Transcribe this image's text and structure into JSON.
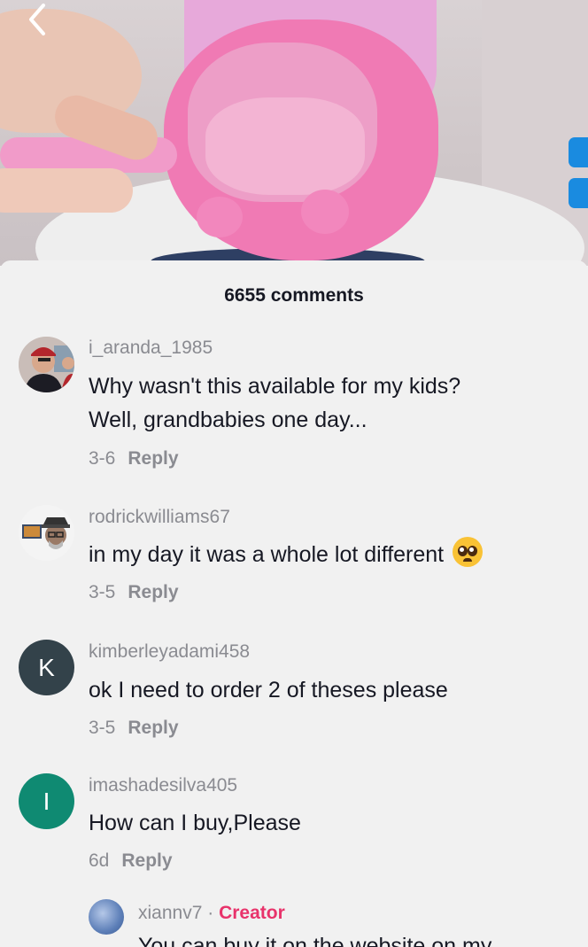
{
  "header": {
    "comment_count": "6655 comments"
  },
  "comments": [
    {
      "username": "i_aranda_1985",
      "text_line1": "Why wasn't this available for my kids?",
      "text_line2": "Well, grandbabies one day...",
      "date": "3-6",
      "reply_label": "Reply"
    },
    {
      "username": "rodrickwilliams67",
      "text": "in my day it was a whole lot different",
      "emoji": "pleading-face-emoji",
      "date": "3-5",
      "reply_label": "Reply"
    },
    {
      "username": "kimberleyadami458",
      "avatar_letter": "K",
      "text": "ok I need to order 2 of theses please",
      "date": "3-5",
      "reply_label": "Reply"
    },
    {
      "username": "imashadesilva405",
      "avatar_letter": "I",
      "text": "How can I buy,Please",
      "date": "6d",
      "reply_label": "Reply"
    }
  ],
  "reply": {
    "username": "xiannv7",
    "separator": "·",
    "badge": "Creator",
    "text_partial": "You can buy it on the website on my"
  },
  "colors": {
    "accent_blue": "#1a8be0",
    "creator_pink": "#e8336b",
    "username_gray": "#8a8b91",
    "text_dark": "#161823"
  },
  "icons": {
    "back": "chevron-left-icon"
  }
}
